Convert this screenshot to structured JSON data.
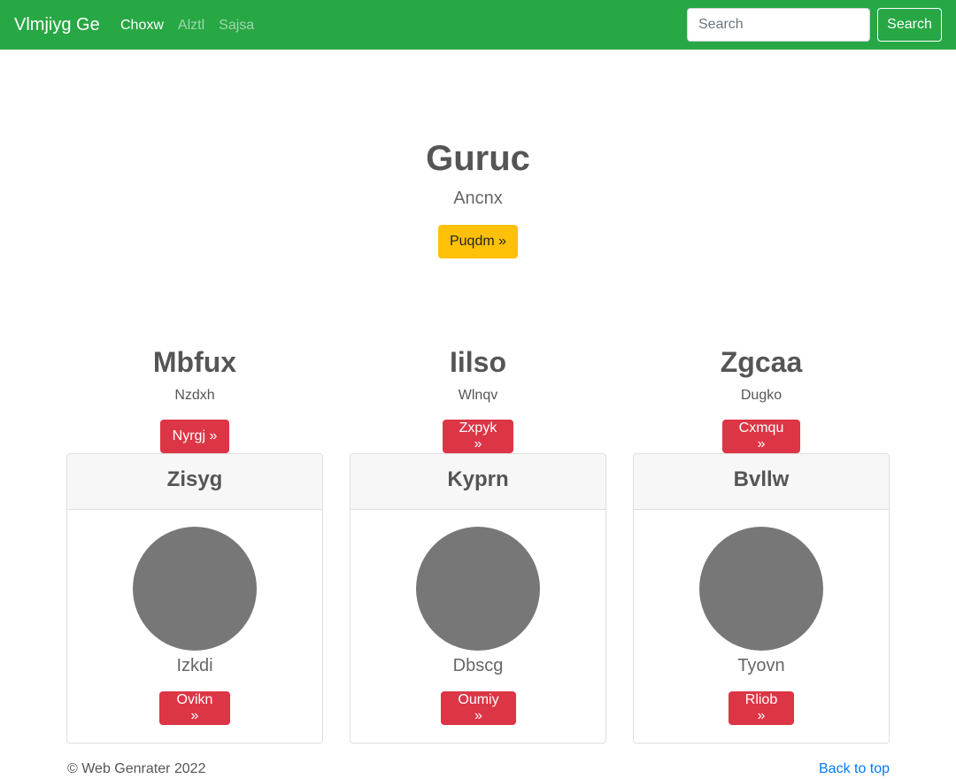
{
  "navbar": {
    "brand": "Vlmjiyg Ge",
    "links": [
      "Choxw",
      "Alztl",
      "Sajsa"
    ],
    "search_placeholder": "Search",
    "search_button": "Search"
  },
  "hero": {
    "title": "Guruc",
    "subtitle": "Ancnx",
    "button": "Puqdm »"
  },
  "columns": [
    {
      "title": "Mbfux",
      "subtitle": "Nzdxh",
      "button": "Nyrgj »"
    },
    {
      "title": "Iilso",
      "subtitle": "Wlnqv",
      "button": "Zxpyk »"
    },
    {
      "title": "Zgcaa",
      "subtitle": "Dugko",
      "button": "Cxmqu »"
    }
  ],
  "cards": [
    {
      "header": "Zisyg",
      "text": "Izkdi",
      "button": "Ovikn »"
    },
    {
      "header": "Kyprn",
      "text": "Dbscg",
      "button": "Oumiy »"
    },
    {
      "header": "Bvllw",
      "text": "Tyovn",
      "button": "Rliob »"
    }
  ],
  "footer": {
    "copyright": "© Web Genrater 2022",
    "back_to_top": "Back to top"
  },
  "colors": {
    "navbar": "#28a745",
    "warning": "#ffc107",
    "danger": "#dc3545",
    "link": "#007bff",
    "avatar": "#777777"
  }
}
